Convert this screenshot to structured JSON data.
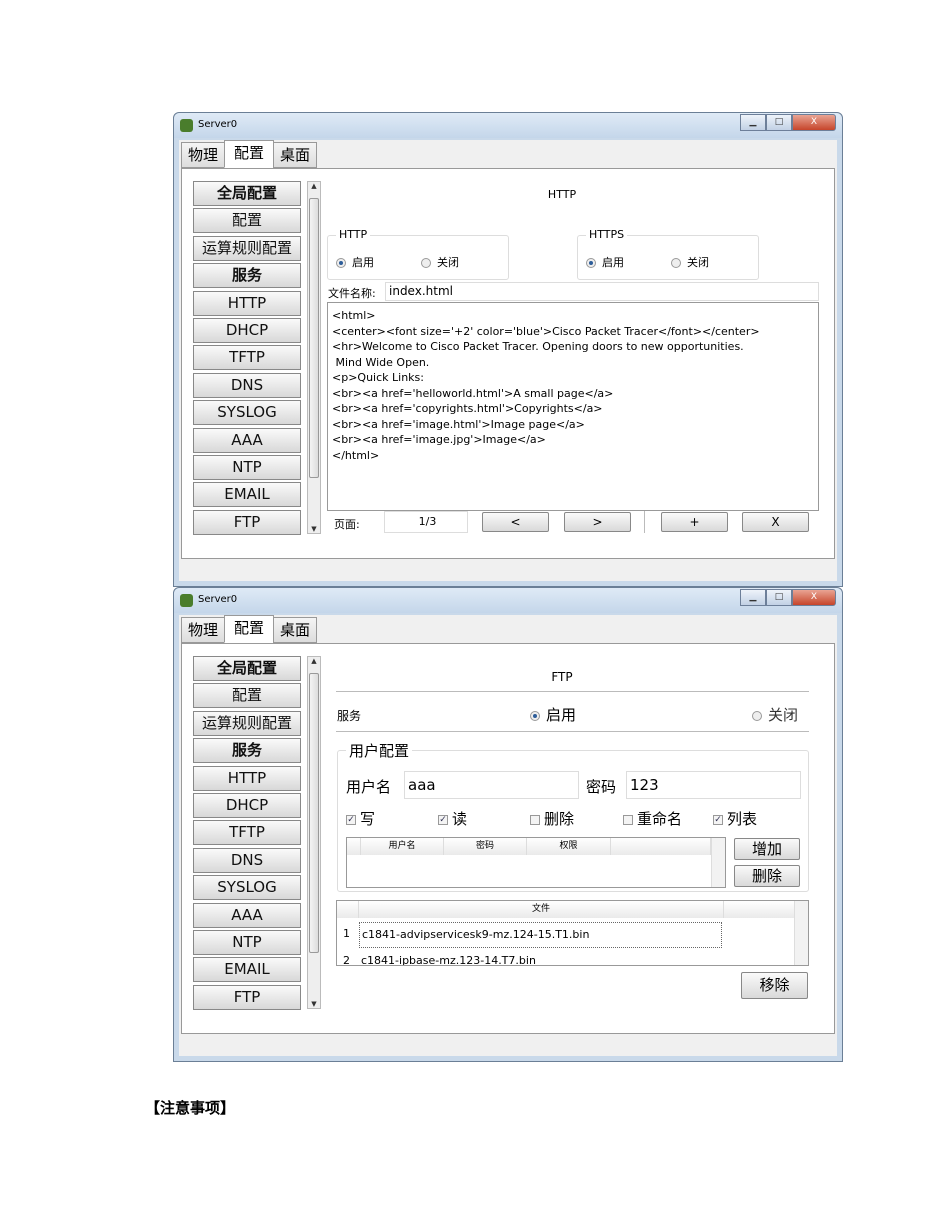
{
  "window_title": "Server0",
  "tabs": [
    "物理",
    "配置",
    "桌面"
  ],
  "sidebar": [
    "全局配置",
    "配置",
    "运算规则配置",
    "服务",
    "HTTP",
    "DHCP",
    "TFTP",
    "DNS",
    "SYSLOG",
    "AAA",
    "NTP",
    "EMAIL",
    "FTP"
  ],
  "http": {
    "title": "HTTP",
    "http_group": "HTTP",
    "https_group": "HTTPS",
    "on": "启用",
    "off": "关闭",
    "file_label": "文件名称:",
    "file_value": "index.html",
    "code": "<html>\n<center><font size='+2' color='blue'>Cisco Packet Tracer</font></center>\n<hr>Welcome to Cisco Packet Tracer. Opening doors to new opportunities.\n Mind Wide Open.\n<p>Quick Links:\n<br><a href='helloworld.html'>A small page</a>\n<br><a href='copyrights.html'>Copyrights</a>\n<br><a href='image.html'>Image page</a>\n<br><a href='image.jpg'>Image</a>\n</html>",
    "page_label": "页面:",
    "page_value": "1/3",
    "prev": "<",
    "next": ">",
    "add": "+",
    "remove": "X"
  },
  "ftp": {
    "title": "FTP",
    "service_label": "服务",
    "on": "启用",
    "off": "关闭",
    "user_group": "用户配置",
    "username_label": "用户名",
    "username": "aaa",
    "password_label": "密码",
    "password": "123",
    "perms": [
      {
        "label": "写",
        "checked": true
      },
      {
        "label": "读",
        "checked": true
      },
      {
        "label": "删除",
        "checked": false
      },
      {
        "label": "重命名",
        "checked": false
      },
      {
        "label": "列表",
        "checked": true
      }
    ],
    "user_cols": [
      "用户名",
      "密码",
      "权限"
    ],
    "add": "增加",
    "delete": "删除",
    "file_col": "文件",
    "files": [
      {
        "n": "1",
        "name": "c1841-advipservicesk9-mz.124-15.T1.bin"
      },
      {
        "n": "2",
        "name": "c1841-ipbase-mz.123-14.T7.bin"
      }
    ],
    "remove": "移除"
  },
  "footer": "【注意事项】"
}
